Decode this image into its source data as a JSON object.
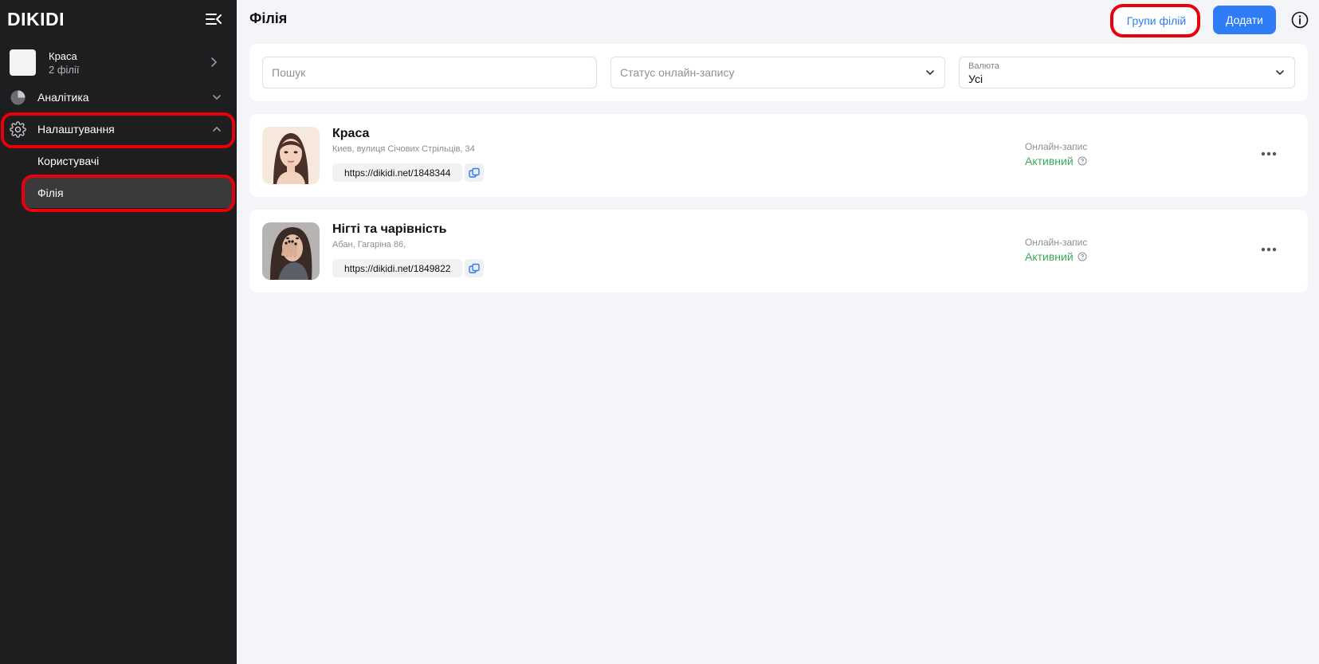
{
  "sidebar": {
    "logo": "DIKIDI",
    "company": {
      "name": "Краса",
      "subtitle": "2 філії"
    },
    "nav": [
      {
        "label": "Аналітика",
        "icon": "pie-chart-icon"
      },
      {
        "label": "Налаштування",
        "icon": "gear-icon"
      }
    ],
    "settings_items": [
      {
        "label": "Користувачі"
      },
      {
        "label": "Філія"
      }
    ]
  },
  "header": {
    "title": "Філія",
    "groups_button": "Групи філій",
    "add_button": "Додати"
  },
  "filters": {
    "search_placeholder": "Пошук",
    "status_placeholder": "Статус онлайн-запису",
    "currency_label": "Валюта",
    "currency_value": "Усі"
  },
  "branches": [
    {
      "name": "Краса",
      "address": "Киев, вулиця Січових Стрільців, 34",
      "link": "https://dikidi.net/1848344",
      "online_label": "Онлайн-запис",
      "online_status": "Активний"
    },
    {
      "name": "Нігті та чарівність",
      "address": "Абан, Гагаріна 86,",
      "link": "https://dikidi.net/1849822",
      "online_label": "Онлайн-запис",
      "online_status": "Активний"
    }
  ],
  "colors": {
    "accent": "#2e7cf6",
    "sidebar_bg": "#1e1e20",
    "active_status": "#3aaa5a",
    "highlight": "#e8000b"
  }
}
